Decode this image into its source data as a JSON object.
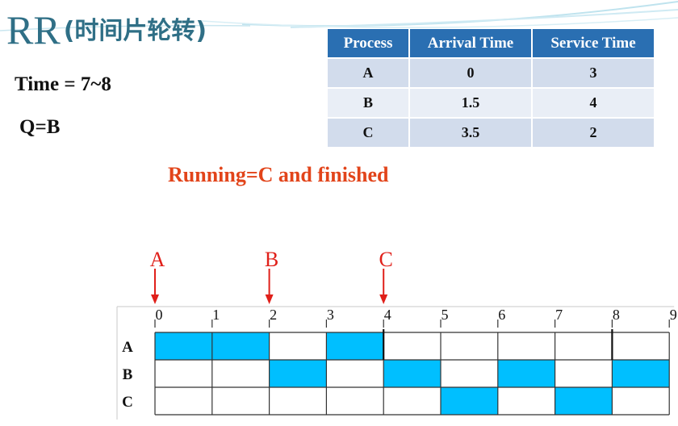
{
  "title": {
    "main": "RR",
    "sub": "(时间片轮转)"
  },
  "status": {
    "time": "Time = 7~8",
    "queue": "Q=B",
    "running": "Running=C and finished"
  },
  "colors": {
    "title": "#2f6f86",
    "table_header": "#2a6fb2",
    "table_row_odd": "#d2dcec",
    "table_row_even": "#e9eef6",
    "bar_fill": "#00bfff",
    "arrival_marker": "#e0201a",
    "running_text": "#e2441a"
  },
  "process_table": {
    "headers": [
      "Process",
      "Arrival Time",
      "Service Time"
    ],
    "rows": [
      [
        "A",
        "0",
        "3"
      ],
      [
        "B",
        "1.5",
        "4"
      ],
      [
        "C",
        "3.5",
        "2"
      ]
    ]
  },
  "gantt": {
    "ticks": [
      "0",
      "1",
      "2",
      "3",
      "4",
      "5",
      "6",
      "7",
      "8",
      "9"
    ],
    "rows": [
      "A",
      "B",
      "C"
    ],
    "segments": [
      {
        "process": "A",
        "start": 0,
        "end": 1
      },
      {
        "process": "A",
        "start": 1,
        "end": 2
      },
      {
        "process": "B",
        "start": 2,
        "end": 3
      },
      {
        "process": "A",
        "start": 3,
        "end": 4
      },
      {
        "process": "B",
        "start": 4,
        "end": 5
      },
      {
        "process": "C",
        "start": 5,
        "end": 6
      },
      {
        "process": "B",
        "start": 6,
        "end": 7
      },
      {
        "process": "C",
        "start": 7,
        "end": 8
      },
      {
        "process": "B",
        "start": 8,
        "end": 9
      }
    ],
    "arrivals": [
      {
        "label": "A",
        "time": 0
      },
      {
        "label": "B",
        "time": 2
      },
      {
        "label": "C",
        "time": 4
      }
    ],
    "completion_marks": [
      {
        "process": "A",
        "time": 4
      },
      {
        "process": "A",
        "time": 8
      }
    ]
  }
}
